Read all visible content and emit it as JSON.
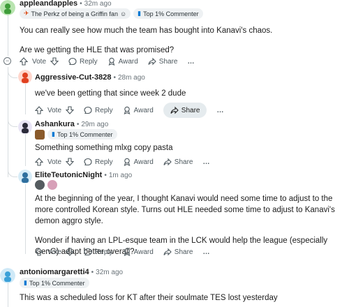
{
  "comments": [
    {
      "author": "appleandapples",
      "time": "32m ago",
      "flairs": [
        "The Perkz of being a Griffin fan",
        "Top 1% Commenter"
      ],
      "paragraphs": [
        "You can really see how much the team has bought into Kanavi's chaos.",
        "Are we getting the HLE that was promised?"
      ]
    },
    {
      "author": "Aggressive-Cut-3828",
      "time": "28m ago",
      "paragraphs": [
        "we've been getting that since week 2 dude"
      ]
    },
    {
      "author": "Ashankura",
      "time": "29m ago",
      "flairs": [
        "Top 1% Commenter"
      ],
      "paragraphs": [
        "Something something mlxg copy pasta"
      ]
    },
    {
      "author": "EliteTeutonicNight",
      "time": "1m ago",
      "paragraphs": [
        "At the beginning of the year, I thought Kanavi would need some time to adjust to the more controlled Korean style. Turns out HLE needed some time to adjust to Kanavi's demon aggro style.",
        "Wonder if having an LPL-esque team in the LCK would help the league (especially GenG) adapt better overall?"
      ]
    },
    {
      "author": "antoniomargaretti4",
      "time": "32m ago",
      "flairs": [
        "Top 1% Commenter"
      ],
      "paragraphs": [
        "This was a scheduled loss for KT after their soulmate TES lost yesterday"
      ]
    }
  ],
  "actions": {
    "vote": "Vote",
    "reply": "Reply",
    "award": "Award",
    "share": "Share",
    "more": "…"
  },
  "colors": {
    "accent_red": "#d93a00",
    "flair_bg": "#eef1f3",
    "share_highlight": "#e5ebee",
    "thread_line": "#d8dde0",
    "meta_gray": "#6a7379"
  }
}
